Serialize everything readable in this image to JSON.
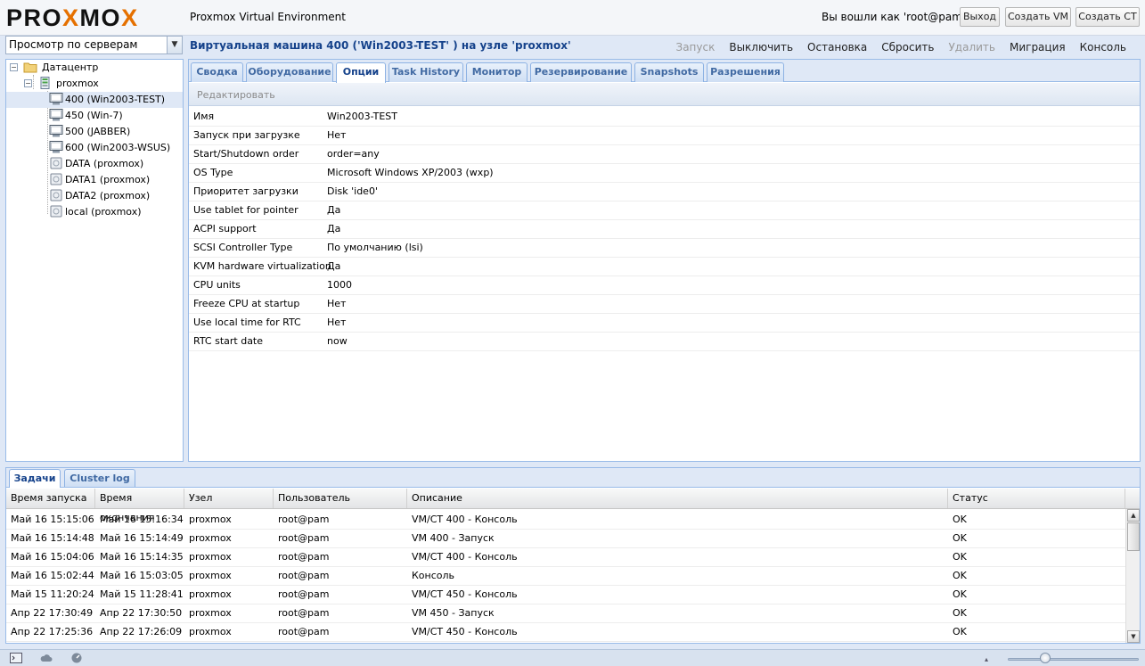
{
  "header": {
    "logo_text": "PROXMOX",
    "app_title": "Proxmox Virtual Environment",
    "login_text": "Вы вошли как 'root@pam'",
    "logout_label": "Выход",
    "create_vm_label": "Создать VM",
    "create_ct_label": "Создать CT"
  },
  "view_selector": {
    "value": "Просмотр по серверам"
  },
  "content_title": "Виртуальная машина 400 ('Win2003-TEST' ) на узле 'proxmox'",
  "actions": {
    "start": "Запуск",
    "shutdown": "Выключить",
    "stop": "Остановка",
    "reset": "Сбросить",
    "remove": "Удалить",
    "migrate": "Миграция",
    "console": "Консоль"
  },
  "tree": {
    "datacenter": "Датацентр",
    "node": "proxmox",
    "vms": [
      "400 (Win2003-TEST)",
      "450 (Win-7)",
      "500 (JABBER)",
      "600 (Win2003-WSUS)"
    ],
    "storages": [
      "DATA (proxmox)",
      "DATA1 (proxmox)",
      "DATA2 (proxmox)",
      "local (proxmox)"
    ],
    "selected": "400 (Win2003-TEST)"
  },
  "tabs": [
    "Сводка",
    "Оборудование",
    "Опции",
    "Task History",
    "Монитор",
    "Резервирование",
    "Snapshots",
    "Разрешения"
  ],
  "active_tab": "Опции",
  "edit_label": "Редактировать",
  "options": [
    {
      "key": "Имя",
      "value": "Win2003-TEST"
    },
    {
      "key": "Запуск при загрузке",
      "value": "Нет"
    },
    {
      "key": "Start/Shutdown order",
      "value": "order=any"
    },
    {
      "key": "OS Type",
      "value": "Microsoft Windows XP/2003 (wxp)"
    },
    {
      "key": "Приоритет загрузки",
      "value": "Disk 'ide0'"
    },
    {
      "key": "Use tablet for pointer",
      "value": "Да"
    },
    {
      "key": "ACPI support",
      "value": "Да"
    },
    {
      "key": "SCSI Controller Type",
      "value": "По умолчанию (lsi)"
    },
    {
      "key": "KVM hardware virtualization",
      "value": "Да"
    },
    {
      "key": "CPU units",
      "value": "1000"
    },
    {
      "key": "Freeze CPU at startup",
      "value": "Нет"
    },
    {
      "key": "Use local time for RTC",
      "value": "Нет"
    },
    {
      "key": "RTC start date",
      "value": "now"
    }
  ],
  "bottom_tabs": [
    "Задачи",
    "Cluster log"
  ],
  "bottom_active_tab": "Задачи",
  "tasks": {
    "columns": [
      "Время запуска",
      "Время окончания",
      "Узел",
      "Пользователь",
      "Описание",
      "Статус"
    ],
    "rows": [
      [
        "Май 16 15:15:06",
        "Май 16 15:16:34",
        "proxmox",
        "root@pam",
        "VM/CT 400 - Консоль",
        "OK"
      ],
      [
        "Май 16 15:14:48",
        "Май 16 15:14:49",
        "proxmox",
        "root@pam",
        "VM 400 - Запуск",
        "OK"
      ],
      [
        "Май 16 15:04:06",
        "Май 16 15:14:35",
        "proxmox",
        "root@pam",
        "VM/CT 400 - Консоль",
        "OK"
      ],
      [
        "Май 16 15:02:44",
        "Май 16 15:03:05",
        "proxmox",
        "root@pam",
        "Консоль",
        "OK"
      ],
      [
        "Май 15 11:20:24",
        "Май 15 11:28:41",
        "proxmox",
        "root@pam",
        "VM/CT 450 - Консоль",
        "OK"
      ],
      [
        "Апр 22 17:30:49",
        "Апр 22 17:30:50",
        "proxmox",
        "root@pam",
        "VM 450 - Запуск",
        "OK"
      ],
      [
        "Апр 22 17:25:36",
        "Апр 22 17:26:09",
        "proxmox",
        "root@pam",
        "VM/CT 450 - Консоль",
        "OK"
      ]
    ]
  },
  "colors": {
    "accent": "#15428b",
    "logo_x": "#e57000",
    "panel_bg": "#dfe8f6"
  }
}
